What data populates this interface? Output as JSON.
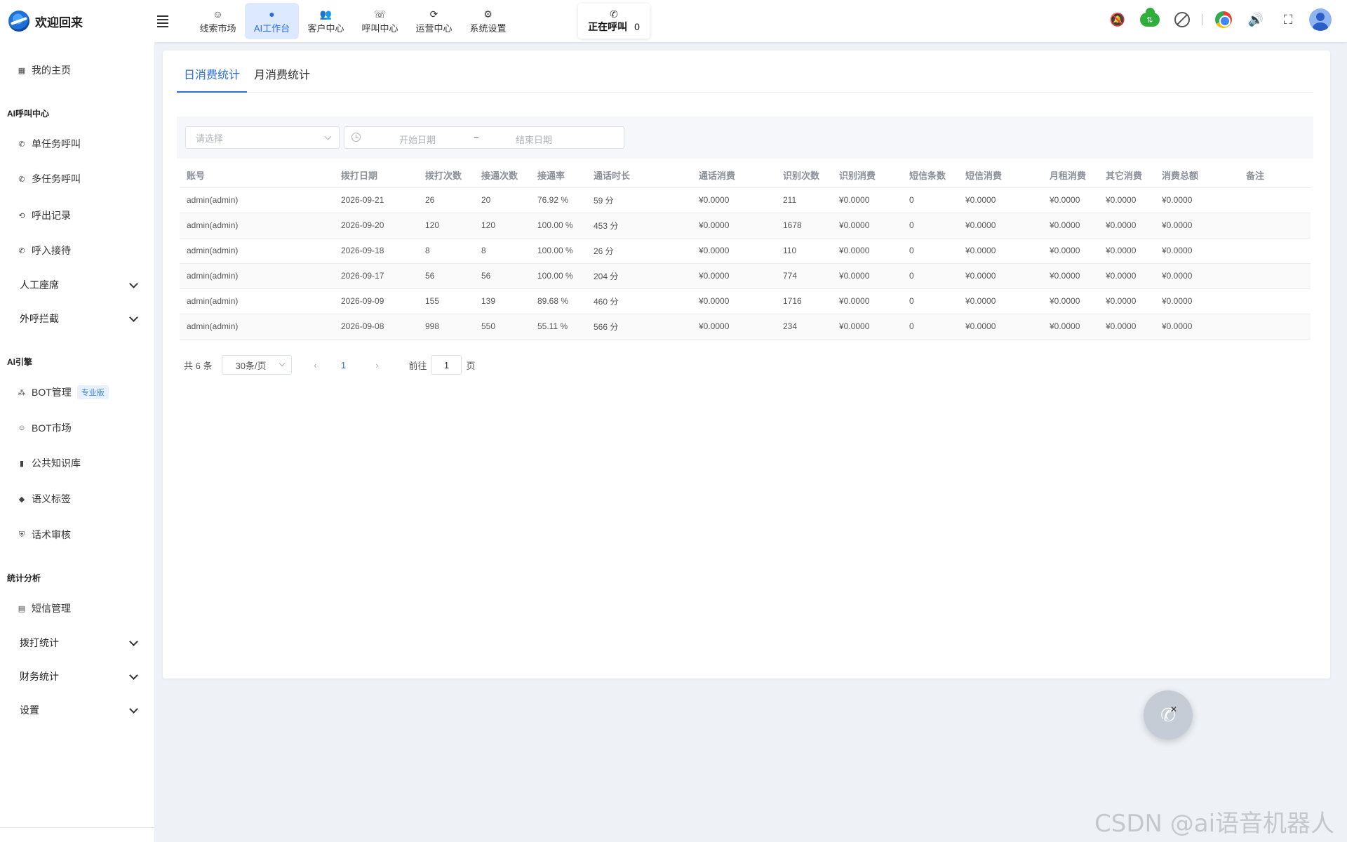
{
  "header": {
    "brand_title": "欢迎回来",
    "nav": [
      {
        "label": "线索市场",
        "icon": "☺"
      },
      {
        "label": "AI工作台",
        "icon": "●"
      },
      {
        "label": "客户中心",
        "icon": "👥"
      },
      {
        "label": "呼叫中心",
        "icon": "☏"
      },
      {
        "label": "运营中心",
        "icon": "⟳"
      },
      {
        "label": "系统设置",
        "icon": "⚙"
      }
    ],
    "calling_label": "正在呼叫",
    "calling_count": "0"
  },
  "sidebar": {
    "home": "我的主页",
    "groups": [
      "AI呼叫中心",
      "AI引擎",
      "统计分析"
    ],
    "call_items": [
      "单任务呼叫",
      "多任务呼叫",
      "呼出记录",
      "呼入接待"
    ],
    "call_expand": [
      "人工座席",
      "外呼拦截"
    ],
    "engine_items": [
      "BOT管理",
      "BOT市场",
      "公共知识库",
      "语义标签",
      "话术审核"
    ],
    "bot_badge": "专业版",
    "stats_items": [
      "短信管理"
    ],
    "stats_expand": [
      "拨打统计",
      "财务统计",
      "设置"
    ]
  },
  "tabs": [
    "日消费统计",
    "月消费统计"
  ],
  "filters": {
    "select_placeholder": "请选择",
    "start_date": "开始日期",
    "separator": "~",
    "end_date": "结束日期"
  },
  "table": {
    "columns": [
      "账号",
      "拨打日期",
      "拨打次数",
      "接通次数",
      "接通率",
      "通话时长",
      "通话消费",
      "识别次数",
      "识别消费",
      "短信条数",
      "短信消费",
      "月租消费",
      "其它消费",
      "消费总额",
      "备注"
    ],
    "rows": [
      [
        "admin(admin)",
        "2026-09-21",
        "26",
        "20",
        "76.92 %",
        "59 分",
        "¥0.0000",
        "211",
        "¥0.0000",
        "0",
        "¥0.0000",
        "¥0.0000",
        "¥0.0000",
        "¥0.0000",
        ""
      ],
      [
        "admin(admin)",
        "2026-09-20",
        "120",
        "120",
        "100.00 %",
        "453 分",
        "¥0.0000",
        "1678",
        "¥0.0000",
        "0",
        "¥0.0000",
        "¥0.0000",
        "¥0.0000",
        "¥0.0000",
        ""
      ],
      [
        "admin(admin)",
        "2026-09-18",
        "8",
        "8",
        "100.00 %",
        "26 分",
        "¥0.0000",
        "110",
        "¥0.0000",
        "0",
        "¥0.0000",
        "¥0.0000",
        "¥0.0000",
        "¥0.0000",
        ""
      ],
      [
        "admin(admin)",
        "2026-09-17",
        "56",
        "56",
        "100.00 %",
        "204 分",
        "¥0.0000",
        "774",
        "¥0.0000",
        "0",
        "¥0.0000",
        "¥0.0000",
        "¥0.0000",
        "¥0.0000",
        ""
      ],
      [
        "admin(admin)",
        "2026-09-09",
        "155",
        "139",
        "89.68 %",
        "460 分",
        "¥0.0000",
        "1716",
        "¥0.0000",
        "0",
        "¥0.0000",
        "¥0.0000",
        "¥0.0000",
        "¥0.0000",
        ""
      ],
      [
        "admin(admin)",
        "2026-09-08",
        "998",
        "550",
        "55.11 %",
        "566 分",
        "¥0.0000",
        "234",
        "¥0.0000",
        "0",
        "¥0.0000",
        "¥0.0000",
        "¥0.0000",
        "¥0.0000",
        ""
      ]
    ]
  },
  "pagination": {
    "total": "共 6 条",
    "page_size": "30条/页",
    "current_page": "1",
    "goto_label": "前往",
    "goto_value": "1",
    "page_suffix": "页"
  },
  "watermark": "CSDN @ai语音机器人",
  "colors": {
    "accent": "#2b6de0",
    "bell": "#e53935",
    "cloud": "#2fae3a"
  }
}
